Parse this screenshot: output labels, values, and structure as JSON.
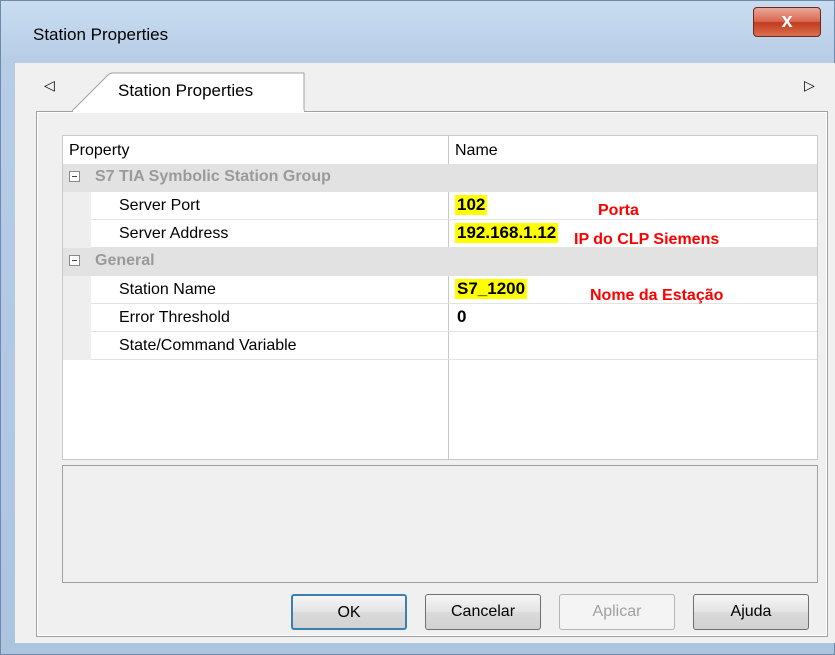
{
  "window": {
    "title": "Station Properties",
    "close_label": "x"
  },
  "tab": {
    "label": "Station Properties",
    "left_arrow": "◁",
    "right_arrow": "▷"
  },
  "grid": {
    "headers": {
      "property": "Property",
      "name": "Name"
    },
    "groups": [
      {
        "label": "S7 TIA Symbolic Station Group"
      },
      {
        "label": "General"
      }
    ],
    "rows": [
      {
        "property": "Server Port",
        "value": "102",
        "highlighted": true
      },
      {
        "property": "Server Address",
        "value": "192.168.1.12",
        "highlighted": true
      },
      {
        "property": "Station Name",
        "value": "S7_1200",
        "highlighted": true
      },
      {
        "property": "Error Threshold",
        "value": "0",
        "highlighted": false
      },
      {
        "property": "State/Command Variable",
        "value": "",
        "highlighted": false
      }
    ]
  },
  "annotations": {
    "port": "Porta",
    "ip": "IP do CLP Siemens",
    "station_name": "Nome da Estação",
    "color": "#ff0000",
    "highlight_color": "#ffff00"
  },
  "buttons": {
    "ok": "OK",
    "cancel": "Cancelar",
    "apply": "Aplicar",
    "help": "Ajuda"
  }
}
